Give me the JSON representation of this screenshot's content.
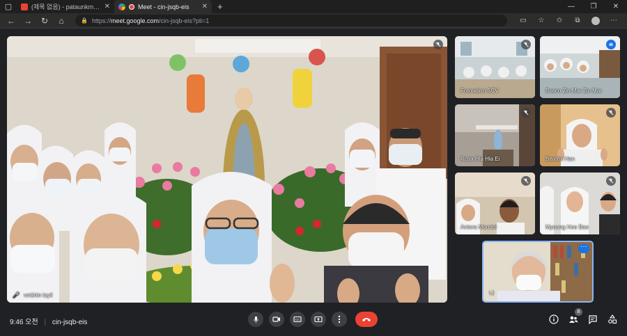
{
  "browser": {
    "tabs": [
      {
        "label": "(제목 없음) - pataunkmay@gmai",
        "active": false
      },
      {
        "label": "Meet - cin-jsqb-eis",
        "active": true
      }
    ],
    "new_tab": "+",
    "url_scheme": "https://",
    "url_host": "meet.google.com",
    "url_path": "/cin-jsqb-eis?pli=1"
  },
  "meeting": {
    "time": "9:46 오전",
    "code": "cin-jsqb-eis",
    "participant_count": "8"
  },
  "main_speaker": {
    "name": "vmkhin layll"
  },
  "tiles": [
    {
      "name": "Formation SCV",
      "status": "mic-off"
    },
    {
      "name": "Bosco Zin Mar Zin Mar",
      "status": "speaking"
    },
    {
      "name": "Rosa Hla Hla Ei",
      "status": "mic-off"
    },
    {
      "name": "Beatrix Han",
      "status": "mic-off"
    },
    {
      "name": "Antora Mondol",
      "status": "mic-off"
    },
    {
      "name": "Myoung Hee Bae",
      "status": "mic-off"
    },
    {
      "name": "나",
      "status": "self"
    }
  ],
  "colors": {
    "end_call": "#ea4335",
    "accent": "#1a73e8",
    "bar": "#202124"
  }
}
